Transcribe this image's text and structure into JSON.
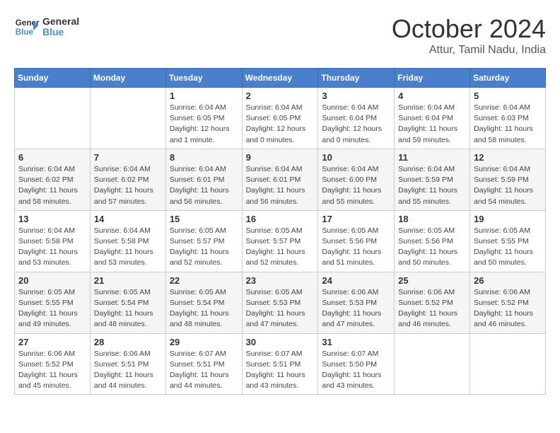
{
  "logo": {
    "line1": "General",
    "line2": "Blue"
  },
  "title": "October 2024",
  "location": "Attur, Tamil Nadu, India",
  "weekdays": [
    "Sunday",
    "Monday",
    "Tuesday",
    "Wednesday",
    "Thursday",
    "Friday",
    "Saturday"
  ],
  "weeks": [
    [
      {
        "day": "",
        "info": ""
      },
      {
        "day": "",
        "info": ""
      },
      {
        "day": "1",
        "info": "Sunrise: 6:04 AM\nSunset: 6:05 PM\nDaylight: 12 hours\nand 1 minute."
      },
      {
        "day": "2",
        "info": "Sunrise: 6:04 AM\nSunset: 6:05 PM\nDaylight: 12 hours\nand 0 minutes."
      },
      {
        "day": "3",
        "info": "Sunrise: 6:04 AM\nSunset: 6:04 PM\nDaylight: 12 hours\nand 0 minutes."
      },
      {
        "day": "4",
        "info": "Sunrise: 6:04 AM\nSunset: 6:04 PM\nDaylight: 11 hours\nand 59 minutes."
      },
      {
        "day": "5",
        "info": "Sunrise: 6:04 AM\nSunset: 6:03 PM\nDaylight: 11 hours\nand 58 minutes."
      }
    ],
    [
      {
        "day": "6",
        "info": "Sunrise: 6:04 AM\nSunset: 6:02 PM\nDaylight: 11 hours\nand 58 minutes."
      },
      {
        "day": "7",
        "info": "Sunrise: 6:04 AM\nSunset: 6:02 PM\nDaylight: 11 hours\nand 57 minutes."
      },
      {
        "day": "8",
        "info": "Sunrise: 6:04 AM\nSunset: 6:01 PM\nDaylight: 11 hours\nand 56 minutes."
      },
      {
        "day": "9",
        "info": "Sunrise: 6:04 AM\nSunset: 6:01 PM\nDaylight: 11 hours\nand 56 minutes."
      },
      {
        "day": "10",
        "info": "Sunrise: 6:04 AM\nSunset: 6:00 PM\nDaylight: 11 hours\nand 55 minutes."
      },
      {
        "day": "11",
        "info": "Sunrise: 6:04 AM\nSunset: 5:59 PM\nDaylight: 11 hours\nand 55 minutes."
      },
      {
        "day": "12",
        "info": "Sunrise: 6:04 AM\nSunset: 5:59 PM\nDaylight: 11 hours\nand 54 minutes."
      }
    ],
    [
      {
        "day": "13",
        "info": "Sunrise: 6:04 AM\nSunset: 5:58 PM\nDaylight: 11 hours\nand 53 minutes."
      },
      {
        "day": "14",
        "info": "Sunrise: 6:04 AM\nSunset: 5:58 PM\nDaylight: 11 hours\nand 53 minutes."
      },
      {
        "day": "15",
        "info": "Sunrise: 6:05 AM\nSunset: 5:57 PM\nDaylight: 11 hours\nand 52 minutes."
      },
      {
        "day": "16",
        "info": "Sunrise: 6:05 AM\nSunset: 5:57 PM\nDaylight: 11 hours\nand 52 minutes."
      },
      {
        "day": "17",
        "info": "Sunrise: 6:05 AM\nSunset: 5:56 PM\nDaylight: 11 hours\nand 51 minutes."
      },
      {
        "day": "18",
        "info": "Sunrise: 6:05 AM\nSunset: 5:56 PM\nDaylight: 11 hours\nand 50 minutes."
      },
      {
        "day": "19",
        "info": "Sunrise: 6:05 AM\nSunset: 5:55 PM\nDaylight: 11 hours\nand 50 minutes."
      }
    ],
    [
      {
        "day": "20",
        "info": "Sunrise: 6:05 AM\nSunset: 5:55 PM\nDaylight: 11 hours\nand 49 minutes."
      },
      {
        "day": "21",
        "info": "Sunrise: 6:05 AM\nSunset: 5:54 PM\nDaylight: 11 hours\nand 48 minutes."
      },
      {
        "day": "22",
        "info": "Sunrise: 6:05 AM\nSunset: 5:54 PM\nDaylight: 11 hours\nand 48 minutes."
      },
      {
        "day": "23",
        "info": "Sunrise: 6:05 AM\nSunset: 5:53 PM\nDaylight: 11 hours\nand 47 minutes."
      },
      {
        "day": "24",
        "info": "Sunrise: 6:06 AM\nSunset: 5:53 PM\nDaylight: 11 hours\nand 47 minutes."
      },
      {
        "day": "25",
        "info": "Sunrise: 6:06 AM\nSunset: 5:52 PM\nDaylight: 11 hours\nand 46 minutes."
      },
      {
        "day": "26",
        "info": "Sunrise: 6:06 AM\nSunset: 5:52 PM\nDaylight: 11 hours\nand 46 minutes."
      }
    ],
    [
      {
        "day": "27",
        "info": "Sunrise: 6:06 AM\nSunset: 5:52 PM\nDaylight: 11 hours\nand 45 minutes."
      },
      {
        "day": "28",
        "info": "Sunrise: 6:06 AM\nSunset: 5:51 PM\nDaylight: 11 hours\nand 44 minutes."
      },
      {
        "day": "29",
        "info": "Sunrise: 6:07 AM\nSunset: 5:51 PM\nDaylight: 11 hours\nand 44 minutes."
      },
      {
        "day": "30",
        "info": "Sunrise: 6:07 AM\nSunset: 5:51 PM\nDaylight: 11 hours\nand 43 minutes."
      },
      {
        "day": "31",
        "info": "Sunrise: 6:07 AM\nSunset: 5:50 PM\nDaylight: 11 hours\nand 43 minutes."
      },
      {
        "day": "",
        "info": ""
      },
      {
        "day": "",
        "info": ""
      }
    ]
  ]
}
